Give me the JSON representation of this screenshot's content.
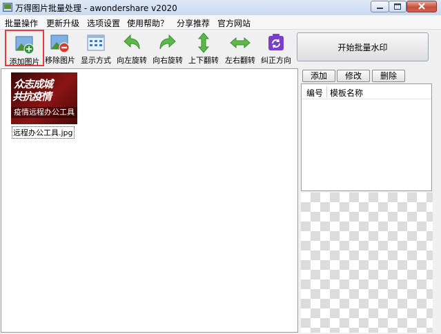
{
  "window": {
    "title": "万得图片批量处理 - awondershare v2020"
  },
  "menu": [
    "批量操作",
    "更新升级",
    "选项设置",
    "使用帮助？",
    "分享推荐",
    "官方网站"
  ],
  "toolbar": {
    "add": "添加图片",
    "remove": "移除图片",
    "display": "显示方式",
    "rotate_left": "向左旋转",
    "rotate_right": "向右旋转",
    "flip_vertical": "上下翻转",
    "flip_horizontal": "左右翻转",
    "correct_orientation": "纠正方向",
    "start": "开始批量水印"
  },
  "images": [
    {
      "filename": "远程办公工具.jpg",
      "thumb_line1": "众志成城",
      "thumb_line2": "共抗疫情",
      "thumb_band": "疫情远程办公工具"
    }
  ],
  "templates": {
    "add": "添加",
    "edit": "修改",
    "delete": "删除",
    "col_id": "编号",
    "col_name": "模板名称"
  },
  "colors": {
    "selected_outline": "#e8383f",
    "add_icon": "#2e9b3a",
    "remove_icon": "#d93a2b",
    "arrow_green": "#5db84a",
    "correct_purple": "#7a3fc9"
  }
}
